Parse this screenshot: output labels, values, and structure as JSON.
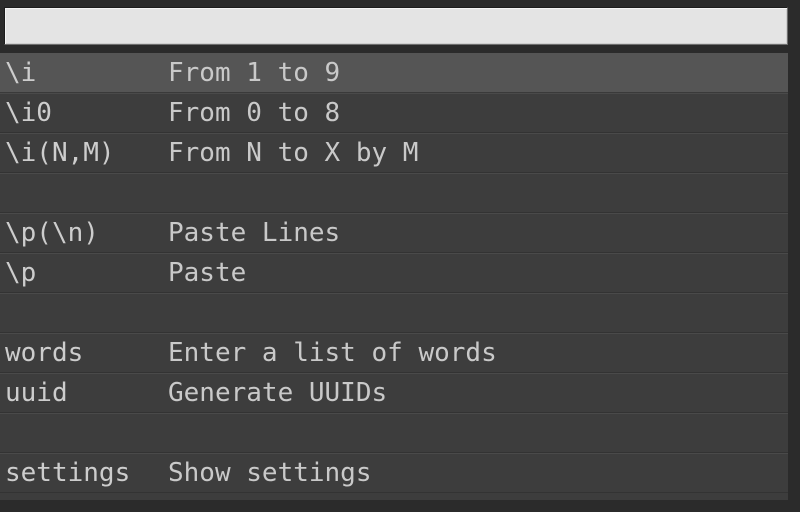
{
  "search": {
    "value": "",
    "placeholder": ""
  },
  "theme": {
    "window_bg": "#2b2b2b",
    "list_bg": "#3d3d3d",
    "row_selected_bg": "#555555",
    "row_border_light": "#4a4a4a",
    "row_border_dark": "#333333",
    "key_text": "#cdcdcd",
    "desc_text": "#c9c9c9",
    "input_bg": "#e4e4e4",
    "input_text": "#101010"
  },
  "commands": [
    {
      "type": "item",
      "key": "\\i",
      "description": "From 1 to 9",
      "selected": true
    },
    {
      "type": "item",
      "key": "\\i0",
      "description": "From 0 to 8",
      "selected": false
    },
    {
      "type": "item",
      "key": "\\i(N,M)",
      "description": "From N to X by M",
      "selected": false
    },
    {
      "type": "spacer",
      "key": "",
      "description": "",
      "selected": false
    },
    {
      "type": "item",
      "key": "\\p(\\n)",
      "description": "Paste Lines",
      "selected": false
    },
    {
      "type": "item",
      "key": "\\p",
      "description": "Paste",
      "selected": false
    },
    {
      "type": "spacer",
      "key": "",
      "description": "",
      "selected": false
    },
    {
      "type": "item",
      "key": "words",
      "description": "Enter a list of words",
      "selected": false
    },
    {
      "type": "item",
      "key": "uuid",
      "description": "Generate UUIDs",
      "selected": false
    },
    {
      "type": "spacer",
      "key": "",
      "description": "",
      "selected": false
    },
    {
      "type": "item",
      "key": "settings",
      "description": "Show settings",
      "selected": false
    }
  ]
}
